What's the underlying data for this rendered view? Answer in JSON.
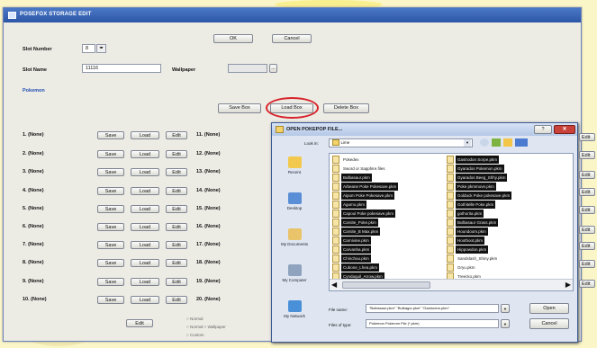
{
  "main": {
    "title": "POSEFOX STORAGE EDIT",
    "ok": "OK",
    "cancel": "Cancel",
    "slot_label": "Slot Number",
    "slot_value": "8",
    "slot_arrows": "◂▸",
    "slot_name_label": "Slot Name",
    "slot_name_value": "11116",
    "wallpaper_label": "Wallpaper",
    "wallpaper_dots": "...",
    "section": "Pokemon",
    "save_box": "Save Box",
    "load_box": "Load Box",
    "delete_box": "Delete Box",
    "rows_left": [
      "1. (None)",
      "2. (None)",
      "3. (None)",
      "4. (None)",
      "5. (None)",
      "6. (None)",
      "7. (None)",
      "8. (None)",
      "9. (None)",
      "10. (None)"
    ],
    "rows_right": [
      "11. (None)",
      "12. (None)",
      "13. (None)",
      "14. (None)",
      "15. (None)",
      "16. (None)",
      "17. (None)",
      "18. (None)",
      "19. (None)",
      "20. (None)"
    ],
    "row_save": "Save",
    "row_load": "Load",
    "row_edit": "Edit",
    "right_edge_edit": "Edit",
    "bottom_edit": "Edit",
    "options": [
      "Normal",
      "Normal + Wallpaper",
      "Custom"
    ]
  },
  "file_dialog": {
    "title": "OPEN POKEPOP FILE...",
    "look_in_label": "Look in:",
    "look_in_value": "Lime",
    "sidebar": [
      {
        "icon": "recent-icon",
        "label": "Recent"
      },
      {
        "icon": "desktop-icon",
        "label": "Desktop"
      },
      {
        "icon": "my-documents-icon",
        "label": "My Documents"
      },
      {
        "icon": "my-computer-icon",
        "label": "My Computer"
      },
      {
        "icon": "my-network-icon",
        "label": "My Network"
      }
    ],
    "files_col1": [
      {
        "name": "Pokedex",
        "plain": true
      },
      {
        "name": "Sword or Sapphire.files",
        "plain": true
      },
      {
        "name": "Bulbasaur.pkm",
        "plain": false
      },
      {
        "name": "Arbeane Poke Pokesave.pkm",
        "plain": false
      },
      {
        "name": "Aipom Poke Pokesave.pkm",
        "plain": false
      },
      {
        "name": "Agumo.pkm",
        "plain": false
      },
      {
        "name": "Capoul Poke pokesave.pkm",
        "plain": false
      },
      {
        "name": "Carsite_Poke.pkm",
        "plain": false
      },
      {
        "name": "Carsite_B Max.pkm",
        "plain": false
      },
      {
        "name": "Carnivine.pkm",
        "plain": false
      },
      {
        "name": "Carvanha.pkm",
        "plain": false
      },
      {
        "name": "Chinchou.pkm",
        "plain": false
      },
      {
        "name": "Cubone_Lhea.pkm",
        "plain": false
      },
      {
        "name": "Cyndaquil_Arrow.pkm",
        "plain": false
      }
    ],
    "files_col2": [
      {
        "name": "Gastrodon Sorpe.pkm",
        "plain": false
      },
      {
        "name": "Gyarados Pokemon.pkm",
        "plain": false
      },
      {
        "name": "Gyarados Beeg_Shhy.pkm",
        "plain": false
      },
      {
        "name": "Poke pkmmove.pkm",
        "plain": false
      },
      {
        "name": "Golduck Poke pokesave.pkm",
        "plain": false
      },
      {
        "name": "Gothitelle Poke.pkm",
        "plain": false
      },
      {
        "name": "gothorita.pkm",
        "plain": false
      },
      {
        "name": "Bulbasaur Grass.pkm",
        "plain": false
      },
      {
        "name": "Houndoom.pkm",
        "plain": false
      },
      {
        "name": "Hoothoot.pkm",
        "plain": false
      },
      {
        "name": "Hippowdon.pkm",
        "plain": false
      },
      {
        "name": "Sandslash_Shiny.pkm",
        "plain": true
      },
      {
        "name": "Gryu.pkm",
        "plain": true
      },
      {
        "name": "Treecko.pkm",
        "plain": true
      }
    ],
    "file_name_label": "File name:",
    "file_name_value": "\"Bulbasaur.pkm\" \"Bulbagor.pkm\" \"Gastrodon.pkm\"",
    "files_type_label": "Files of type:",
    "files_type_value": "Pokemon Pokerom File (*.pkm)",
    "open": "Open",
    "cancel": "Cancel",
    "colors": {
      "accent": "#d8232a",
      "title_bar": "#2c56a6",
      "close": "#c8423a"
    }
  }
}
